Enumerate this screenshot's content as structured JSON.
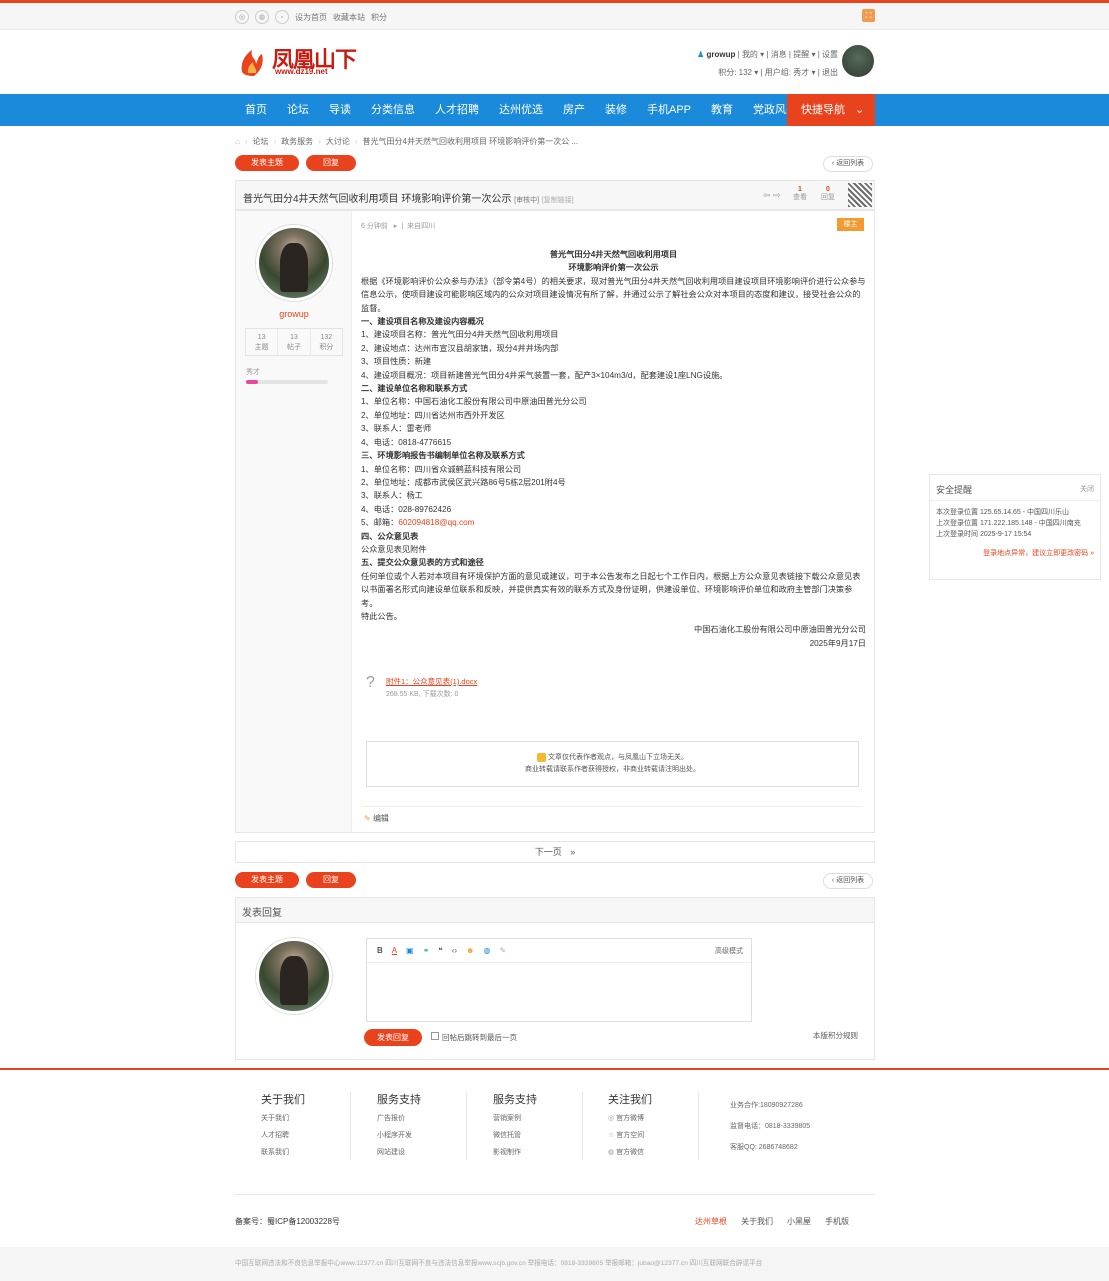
{
  "topbar": {
    "set_home": "设为首页",
    "favorite": "收藏本站",
    "credits": "积分"
  },
  "logo": {
    "name": "凤凰山下",
    "url": "www.dz19.net"
  },
  "user": {
    "username": "growup",
    "links": [
      "我的",
      "消息",
      "提醒",
      "设置"
    ],
    "credits": "积分: 132",
    "group": "用户组: 秀才",
    "logout": "退出"
  },
  "nav": {
    "items": [
      "首页",
      "论坛",
      "导读",
      "分类信息",
      "人才招聘",
      "达州优选",
      "房产",
      "装修",
      "手机APP",
      "教育",
      "党政风采"
    ],
    "quick": "快捷导航"
  },
  "breadcrumb": [
    "论坛",
    "政务服务",
    "大讨论",
    "普光气田分4井天然气回收利用项目 环境影响评价第一次公 ..."
  ],
  "actions": {
    "new_topic": "发表主题",
    "reply": "回复",
    "back": "返回列表"
  },
  "thread": {
    "title": "普光气田分4井天然气回收利用项目 环境影响评价第一次公示",
    "status": "[审核中]",
    "copy": "[复制链接]",
    "views": "1",
    "views_label": "查看",
    "replies": "0",
    "replies_label": "回复"
  },
  "author": {
    "name": "growup",
    "stats": [
      {
        "num": "13",
        "label": "主题"
      },
      {
        "num": "13",
        "label": "帖子"
      },
      {
        "num": "132",
        "label": "积分"
      }
    ],
    "rank": "秀才"
  },
  "post": {
    "meta_time": "6 分钟前",
    "meta_from": "来自四川",
    "owner_tag": "楼主",
    "lines": [
      {
        "t": "c",
        "text": "普光气田分4井天然气回收利用项目"
      },
      {
        "t": "c",
        "text": "环境影响评价第一次公示"
      },
      {
        "t": "p",
        "text": "根据《环境影响评价公众参与办法》（部令第4号）的相关要求，现对普光气田分4井天然气回收利用项目建设项目环境影响评价进行公众参与信息公示，使项目建设可能影响区域内的公众对项目建设情况有所了解，并通过公示了解社会公众对本项目的态度和建议，接受社会公众的监督。"
      },
      {
        "t": "h",
        "text": "一、建设项目名称及建设内容概况"
      },
      {
        "t": "p",
        "text": "1、建设项目名称：普光气田分4井天然气回收利用项目"
      },
      {
        "t": "p",
        "text": "2、建设地点：达州市宣汉县胡家镇，现分4井井场内部"
      },
      {
        "t": "p",
        "text": "3、项目性质：新建"
      },
      {
        "t": "p",
        "text": "4、建设项目概况：项目新建普光气田分4井采气装置一套，配产3×104m3/d，配套建设1座LNG设施。"
      },
      {
        "t": "h",
        "text": "二、建设单位名称和联系方式"
      },
      {
        "t": "p",
        "text": "1、单位名称：中国石油化工股份有限公司中原油田普光分公司"
      },
      {
        "t": "p",
        "text": "2、单位地址：四川省达州市西外开发区"
      },
      {
        "t": "p",
        "text": "3、联系人：雷老师"
      },
      {
        "t": "p",
        "text": "4、电话：0818-4776615"
      },
      {
        "t": "h",
        "text": "三、环境影响报告书编制单位名称及联系方式"
      },
      {
        "t": "p",
        "text": "1、单位名称：四川省众诚鹤蓝科技有限公司"
      },
      {
        "t": "p",
        "text": "2、单位地址：成都市武侯区武兴路86号5栋2层201附4号"
      },
      {
        "t": "p",
        "text": "3、联系人：杨工"
      },
      {
        "t": "p",
        "text": "4、电话：028-89762426"
      },
      {
        "t": "m",
        "text": "5、邮箱：",
        "link": "602094818@qq.com"
      },
      {
        "t": "h",
        "text": "四、公众意见表"
      },
      {
        "t": "p",
        "text": "公众意见表见附件"
      },
      {
        "t": "h",
        "text": "五、提交公众意见表的方式和途径"
      },
      {
        "t": "p",
        "text": "任何单位或个人若对本项目有环境保护方面的意见或建议，可于本公告发布之日起七个工作日内，根据上方公众意见表链接下载公众意见表以书面署名形式向建设单位联系和反映，并提供真实有效的联系方式及身份证明，供建设单位、环境影响评价单位和政府主管部门决策参考。"
      },
      {
        "t": "p",
        "text": "特此公告。"
      },
      {
        "t": "r",
        "text": "中国石油化工股份有限公司中原油田普光分公司"
      },
      {
        "t": "r",
        "text": "2025年9月17日"
      }
    ],
    "attachment_name": "附件1：公众意见表(1).docx",
    "attachment_meta": "268.55 KB, 下载次数: 0",
    "notice1": "文章仅代表作者观点，与凤凰山下立场无关。",
    "notice2": "商业转载请联系作者获得授权，非商业转载请注明出处。",
    "edit": "编辑"
  },
  "pager": {
    "next": "下一页",
    "arrow": "»"
  },
  "reply_box": {
    "title": "发表回复",
    "advanced": "高级模式",
    "submit": "发表回复",
    "jump": "回帖后跳转到最后一页",
    "rules": "本版积分规则"
  },
  "security": {
    "title": "安全提醒",
    "close": "关闭",
    "lines": [
      "本次登录位置 125.65.14.65 - 中国四川乐山",
      "上次登录位置 171.222.185.148 - 中国四川南充",
      "上次登录时间 2025-9-17 15:54"
    ],
    "warn": "登录地点异常，建议立即更改密码 »"
  },
  "footer": {
    "cols": [
      {
        "title": "关于我们",
        "items": [
          "关于我们",
          "人才招聘",
          "联系我们"
        ]
      },
      {
        "title": "服务支持",
        "items": [
          "广告报价",
          "小程序开发",
          "网站建设"
        ]
      },
      {
        "title": "服务支持",
        "items": [
          "营销案例",
          "微信托管",
          "影视制作"
        ]
      },
      {
        "title": "关注我们",
        "items": [
          "官方微博",
          "官方空间",
          "官方微信"
        ]
      }
    ],
    "contact": [
      "业务合作:18090927286",
      "监督电话：0818-3339805",
      "客服QQ: 2686748682"
    ],
    "icp": "备案号：蜀ICP备12003228号",
    "links": [
      "达州草根",
      "关于我们",
      "小黑屋",
      "手机版"
    ],
    "bottom": "中国互联网违法和不良信息举报中心www.12377.cn 四川互联网不良与违法信息举报www.scjb.gov.cn 举报电话：0818-3339805 举报邮箱：jubao@12377.cn 四川互联网联合辟谣平台"
  }
}
